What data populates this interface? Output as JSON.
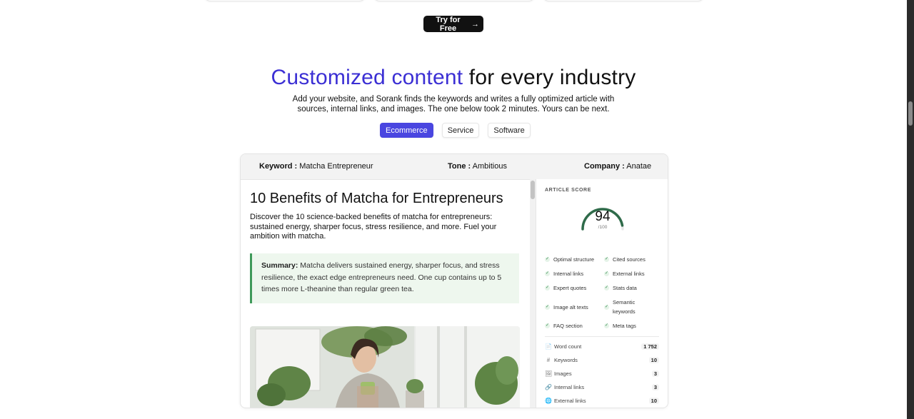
{
  "cta": {
    "label": "Try for Free",
    "arrow": "→"
  },
  "hero": {
    "title_accent": "Customized content",
    "title_rest": " for every industry",
    "subtitle_line1": "Add your website, and Sorank finds the keywords and writes a fully optimized article with",
    "subtitle_line2": "sources, internal links, and images. The one below took 2 minutes. Yours can be next."
  },
  "tabs": [
    {
      "label": "Ecommerce",
      "active": true
    },
    {
      "label": "Service",
      "active": false
    },
    {
      "label": "Software",
      "active": false
    }
  ],
  "panel": {
    "keyword": {
      "label": "Keyword :",
      "value": "Matcha Entrepreneur"
    },
    "tone": {
      "label": "Tone :",
      "value": "Ambitious"
    },
    "company": {
      "label": "Company :",
      "value": "Anatae"
    }
  },
  "article": {
    "title": "10 Benefits of Matcha for Entrepreneurs",
    "lead": "Discover the 10 science-backed benefits of matcha for entrepreneurs: sustained energy, sharper focus, stress resilience, and more. Fuel your ambition with matcha.",
    "summary_label": "Summary:",
    "summary_text": " Matcha delivers sustained energy, sharper focus, and stress resilience, the exact edge entrepreneurs need. One cup contains up to 5 times more L-theanine than regular green tea."
  },
  "score": {
    "label": "ARTICLE SCORE",
    "value": "94",
    "max": "/100",
    "fraction": 0.94,
    "gauge_color": "#2f6b4a",
    "checks": [
      {
        "label": "Optimal structure"
      },
      {
        "label": "Cited sources"
      },
      {
        "label": "Internal links"
      },
      {
        "label": "External links"
      },
      {
        "label": "Expert quotes"
      },
      {
        "label": "Stats data"
      },
      {
        "label": "Image alt texts"
      },
      {
        "label": "Semantic keywords"
      },
      {
        "label": "FAQ section"
      },
      {
        "label": "Meta tags"
      }
    ],
    "stats": [
      {
        "icon": "document-icon",
        "glyph": "📄",
        "label": "Word count",
        "value": "1 752"
      },
      {
        "icon": "hash-icon",
        "glyph": "#",
        "label": "Keywords",
        "value": "10"
      },
      {
        "icon": "image-icon",
        "glyph": "🖼",
        "label": "Images",
        "value": "3"
      },
      {
        "icon": "link-icon",
        "glyph": "🔗",
        "label": "Internal links",
        "value": "3"
      },
      {
        "icon": "globe-icon",
        "glyph": "🌐",
        "label": "External links",
        "value": "10"
      }
    ]
  },
  "colors": {
    "accent": "#3b2fd4",
    "tab_active": "#4a46e0",
    "summary_bg": "#eef7ee",
    "summary_border": "#3f9a5a"
  }
}
